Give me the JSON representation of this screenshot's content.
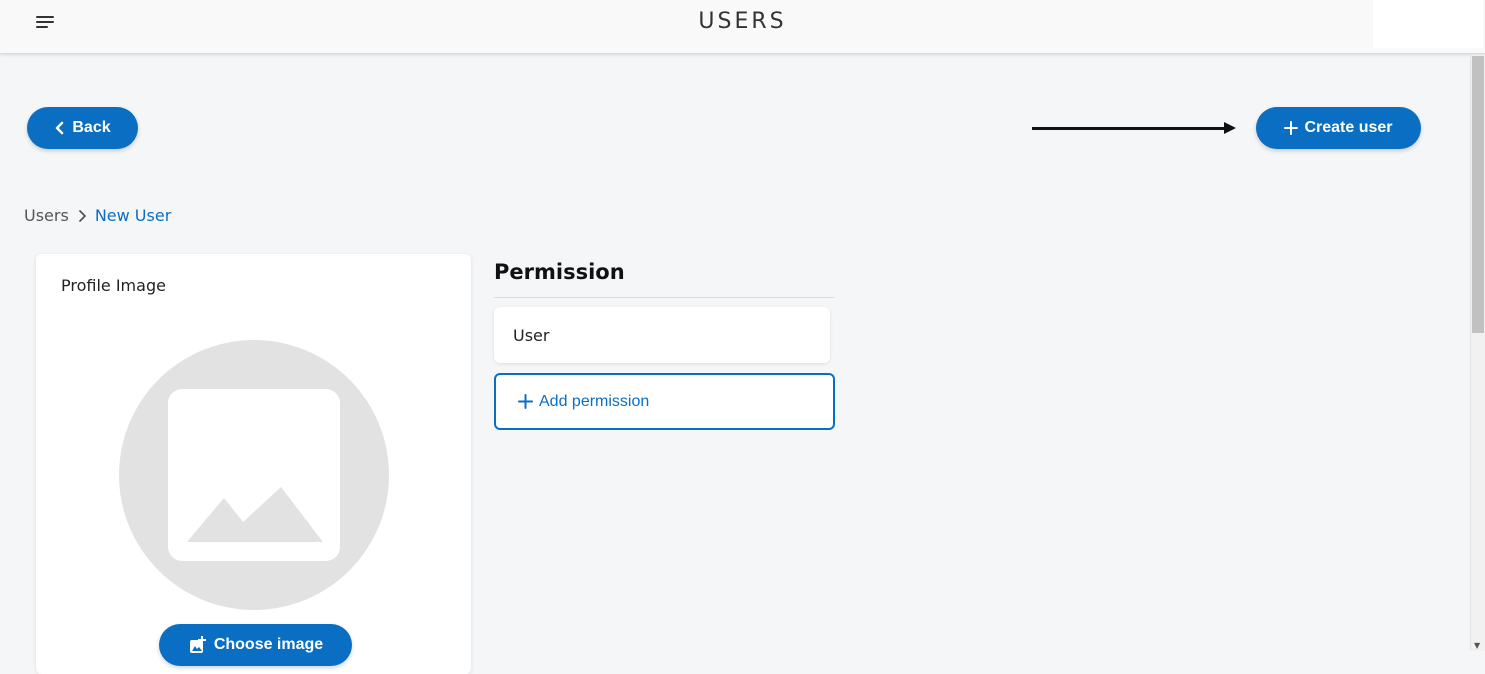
{
  "header": {
    "title": "USERS",
    "menu_icon": "hamburger-menu-icon"
  },
  "actions": {
    "back_label": "Back",
    "back_icon": "chevron-left-icon",
    "create_label": "Create user",
    "create_icon": "plus-icon"
  },
  "breadcrumb": {
    "items": [
      "Users",
      "New User"
    ],
    "separator_icon": "chevron-right-icon"
  },
  "profile": {
    "title": "Profile Image",
    "placeholder_icon": "image-placeholder-icon",
    "choose_label": "Choose image",
    "choose_icon": "add-photo-icon"
  },
  "permissions": {
    "title": "Permission",
    "items": [
      "User"
    ],
    "add_label": "Add permission",
    "add_icon": "plus-icon"
  },
  "colors": {
    "accent": "#0a6fc2",
    "background": "#f5f6f8",
    "card": "#ffffff",
    "placeholder": "#e2e2e2"
  }
}
